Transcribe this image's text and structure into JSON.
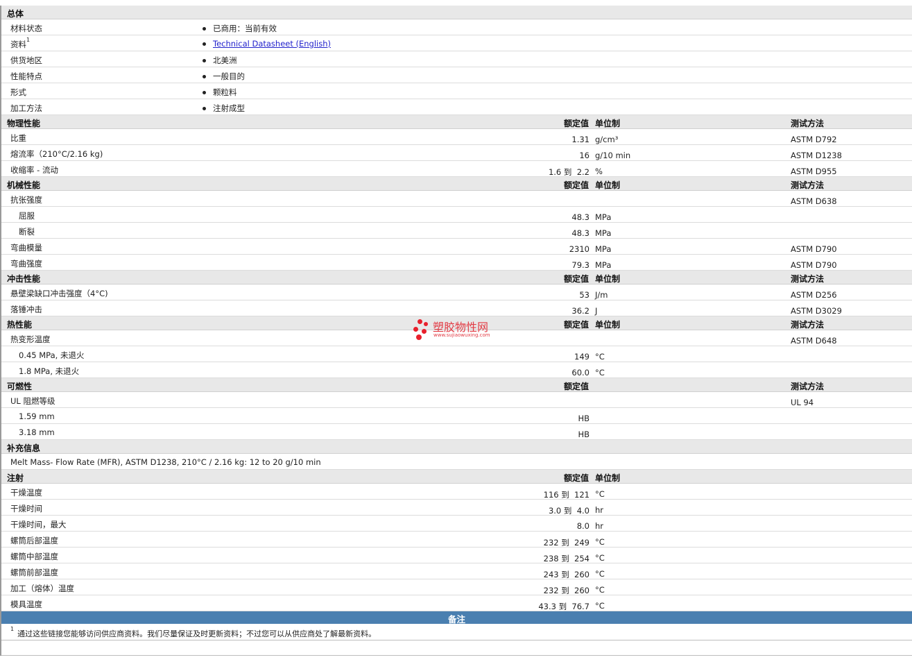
{
  "header_units": {
    "nominal": "额定值",
    "unit": "单位制",
    "test": "测试方法"
  },
  "general": {
    "title": "总体",
    "rows": [
      {
        "label": "材料状态",
        "value": "已商用：当前有效"
      },
      {
        "label": "资料",
        "sup": "1",
        "value": "Technical Datasheet (English)",
        "link": true
      },
      {
        "label": "供货地区",
        "value": "北美洲"
      },
      {
        "label": "性能特点",
        "value": "一般目的"
      },
      {
        "label": "形式",
        "value": "颗粒料"
      },
      {
        "label": "加工方法",
        "value": "注射成型"
      }
    ]
  },
  "sections": [
    {
      "title": "物理性能",
      "show_unit": true,
      "rows": [
        {
          "label": "比重",
          "value": "1.31",
          "unit": "g/cm³",
          "test": "ASTM D792"
        },
        {
          "label": "熔流率（210°C/2.16 kg)",
          "value": "16",
          "unit": "g/10 min",
          "test": "ASTM D1238"
        },
        {
          "label": "收缩率 - 流动",
          "value": "1.6 到  2.2",
          "unit": "%",
          "test": "ASTM D955"
        }
      ]
    },
    {
      "title": "机械性能",
      "show_unit": true,
      "rows": [
        {
          "label": "抗张强度",
          "value": "",
          "unit": "",
          "test": "ASTM D638"
        },
        {
          "label": "屈服",
          "sub": true,
          "value": "48.3",
          "unit": "MPa",
          "test": ""
        },
        {
          "label": "断裂",
          "sub": true,
          "value": "48.3",
          "unit": "MPa",
          "test": ""
        },
        {
          "label": "弯曲模量",
          "value": "2310",
          "unit": "MPa",
          "test": "ASTM D790"
        },
        {
          "label": "弯曲强度",
          "value": "79.3",
          "unit": "MPa",
          "test": "ASTM D790"
        }
      ]
    },
    {
      "title": "冲击性能",
      "show_unit": true,
      "rows": [
        {
          "label": "悬壁梁缺口冲击强度（4°C)",
          "value": "53",
          "unit": "J/m",
          "test": "ASTM D256"
        },
        {
          "label": "落锤冲击",
          "value": "36.2",
          "unit": "J",
          "test": "ASTM D3029"
        }
      ]
    },
    {
      "title": "热性能",
      "show_unit": true,
      "rows": [
        {
          "label": "热变形温度",
          "value": "",
          "unit": "",
          "test": "ASTM D648"
        },
        {
          "label": "0.45 MPa, 未退火",
          "sub": true,
          "value": "149",
          "unit": "°C",
          "test": ""
        },
        {
          "label": "1.8 MPa, 未退火",
          "sub": true,
          "value": "60.0",
          "unit": "°C",
          "test": ""
        }
      ]
    },
    {
      "title": "可燃性",
      "show_unit": false,
      "rows": [
        {
          "label": "UL 阻燃等级",
          "value": "",
          "unit": "",
          "test": "UL 94"
        },
        {
          "label": "1.59 mm",
          "sub": true,
          "value": "HB",
          "unit": "",
          "test": ""
        },
        {
          "label": "3.18 mm",
          "sub": true,
          "value": "HB",
          "unit": "",
          "test": ""
        }
      ]
    }
  ],
  "supplement": {
    "title": "补充信息",
    "text": "Melt Mass- Flow Rate (MFR), ASTM D1238, 210°C / 2.16 kg: 12 to 20 g/10 min"
  },
  "injection": {
    "title": "注射",
    "rows": [
      {
        "label": "干燥温度",
        "value": "116 到  121",
        "unit": "°C"
      },
      {
        "label": "干燥时间",
        "value": "3.0 到  4.0",
        "unit": "hr"
      },
      {
        "label": "干燥时间，最大",
        "value": "8.0",
        "unit": "hr"
      },
      {
        "label": "螺筒后部温度",
        "value": "232 到  249",
        "unit": "°C"
      },
      {
        "label": "螺筒中部温度",
        "value": "238 到  254",
        "unit": "°C"
      },
      {
        "label": "螺筒前部温度",
        "value": "243 到  260",
        "unit": "°C"
      },
      {
        "label": "加工（熔体）温度",
        "value": "232 到  260",
        "unit": "°C"
      },
      {
        "label": "模具温度",
        "value": "43.3 到  76.7",
        "unit": "°C"
      }
    ]
  },
  "notes": {
    "title": "备注",
    "sup": "1",
    "text": "通过这些链接您能够访问供应商资料。我们尽量保证及时更新资料；不过您可以从供应商处了解最新资料。"
  },
  "watermark": {
    "name": "塑胶物性网",
    "url": "www.sujiaowuxing.com"
  }
}
